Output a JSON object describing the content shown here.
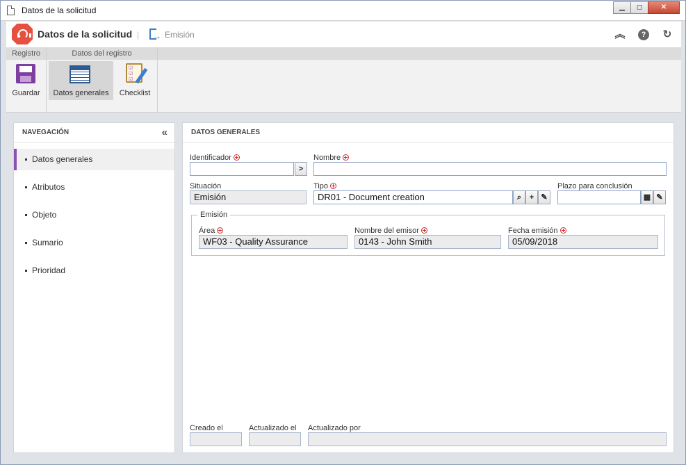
{
  "window": {
    "title": "Datos de la solicitud",
    "buttons": {
      "minimize": "▁",
      "maximize": "◻",
      "close": "✕"
    }
  },
  "header": {
    "title": "Datos de la solicitud",
    "separator": "|",
    "status": "Emisión",
    "icons": [
      "collapse-up-icon",
      "help-icon",
      "refresh-icon"
    ]
  },
  "ribbon": {
    "groups": [
      {
        "label": "Registro"
      },
      {
        "label": "Datos del registro"
      }
    ],
    "buttons": {
      "save": "Guardar",
      "general": "Datos generales",
      "checklist": "Checklist"
    }
  },
  "navigation": {
    "title": "NAVEGACIÓN",
    "items": [
      {
        "label": "Datos generales",
        "active": true
      },
      {
        "label": "Atributos"
      },
      {
        "label": "Objeto"
      },
      {
        "label": "Sumario"
      },
      {
        "label": "Prioridad"
      }
    ]
  },
  "main": {
    "title": "DATOS GENERALES",
    "fields": {
      "identificador": {
        "label": "Identificador",
        "value": ""
      },
      "nombre": {
        "label": "Nombre",
        "value": ""
      },
      "situacion": {
        "label": "Situación",
        "value": "Emisión"
      },
      "tipo": {
        "label": "Tipo",
        "value": "DR01 - Document creation"
      },
      "plazo": {
        "label": "Plazo para conclusión",
        "value": ""
      }
    },
    "emision": {
      "legend": "Emisión",
      "area": {
        "label": "Área",
        "value": "WF03 - Quality Assurance"
      },
      "emisor": {
        "label": "Nombre del emisor",
        "value": "0143 - John Smith"
      },
      "fecha": {
        "label": "Fecha emisión",
        "value": "05/09/2018"
      }
    },
    "footer": {
      "creado": {
        "label": "Creado el",
        "value": ""
      },
      "actualizado": {
        "label": "Actualizado el",
        "value": ""
      },
      "actualizado_por": {
        "label": "Actualizado por",
        "value": ""
      }
    }
  },
  "colors": {
    "accent": "#8e4fb3",
    "logo": "#e6513f",
    "required": "#d12b2b",
    "input_border": "#8ea3c7"
  }
}
